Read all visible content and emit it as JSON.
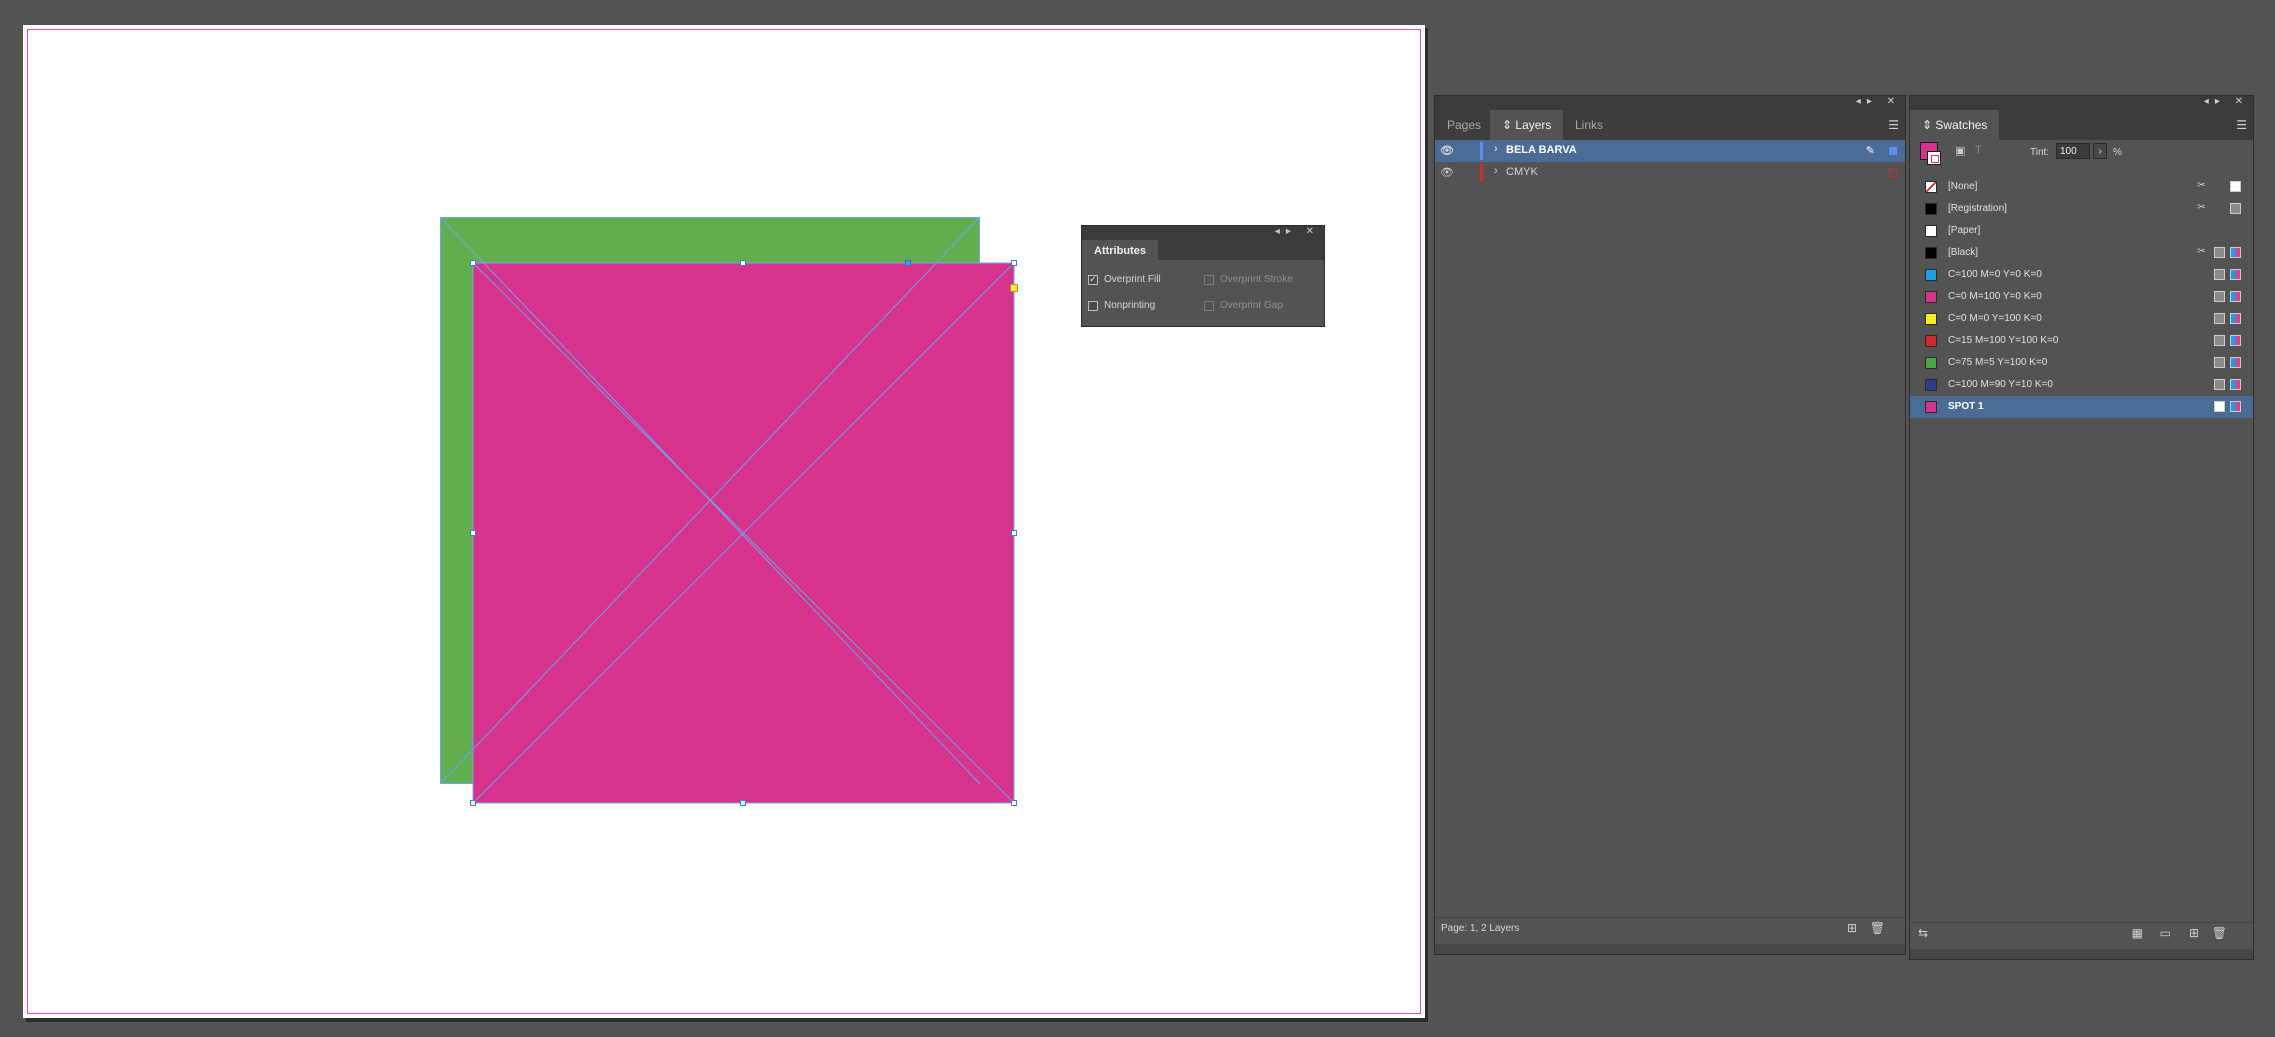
{
  "attributes_panel": {
    "title": "Attributes",
    "overprint_fill": {
      "label": "Overprint Fill",
      "checked": "✓"
    },
    "overprint_stroke": {
      "label": "Overprint Stroke"
    },
    "nonprinting": {
      "label": "Nonprinting"
    },
    "overprint_gap": {
      "label": "Overprint Gap"
    }
  },
  "layers_panel": {
    "tabs": {
      "pages": "Pages",
      "layers": "⇕ Layers",
      "links": "Links"
    },
    "layers": [
      {
        "name": "BELA BARVA",
        "color": "#5f8fe8"
      },
      {
        "name": "CMYK",
        "color": "#d02c2c"
      }
    ],
    "footer": "Page: 1, 2 Layers"
  },
  "swatches_panel": {
    "tab": "⇕ Swatches",
    "tint_label": "Tint:",
    "tint_value": "100",
    "tint_unit": "%",
    "swatches": [
      {
        "name": "[None]",
        "color": "#ffffff"
      },
      {
        "name": "[Registration]",
        "color": "#000000"
      },
      {
        "name": "[Paper]",
        "color": "#ffffff"
      },
      {
        "name": "[Black]",
        "color": "#000000"
      },
      {
        "name": "C=100 M=0 Y=0 K=0",
        "color": "#1aa0e6"
      },
      {
        "name": "C=0 M=100 Y=0 K=0",
        "color": "#d8338c"
      },
      {
        "name": "C=0 M=0 Y=100 K=0",
        "color": "#f6ee22"
      },
      {
        "name": "C=15 M=100 Y=100 K=0",
        "color": "#cc2a2e"
      },
      {
        "name": "C=75 M=5 Y=100 K=0",
        "color": "#4aa447"
      },
      {
        "name": "C=100 M=90 Y=10 K=0",
        "color": "#2a3d8f"
      },
      {
        "name": "SPOT 1",
        "color": "#d8338c"
      }
    ]
  },
  "colors": {
    "green_rectangle": "#62ad4e",
    "magenta_rectangle": "#d8338c",
    "selection": "#4a6b95",
    "margin_guide": "#d24fd6"
  }
}
